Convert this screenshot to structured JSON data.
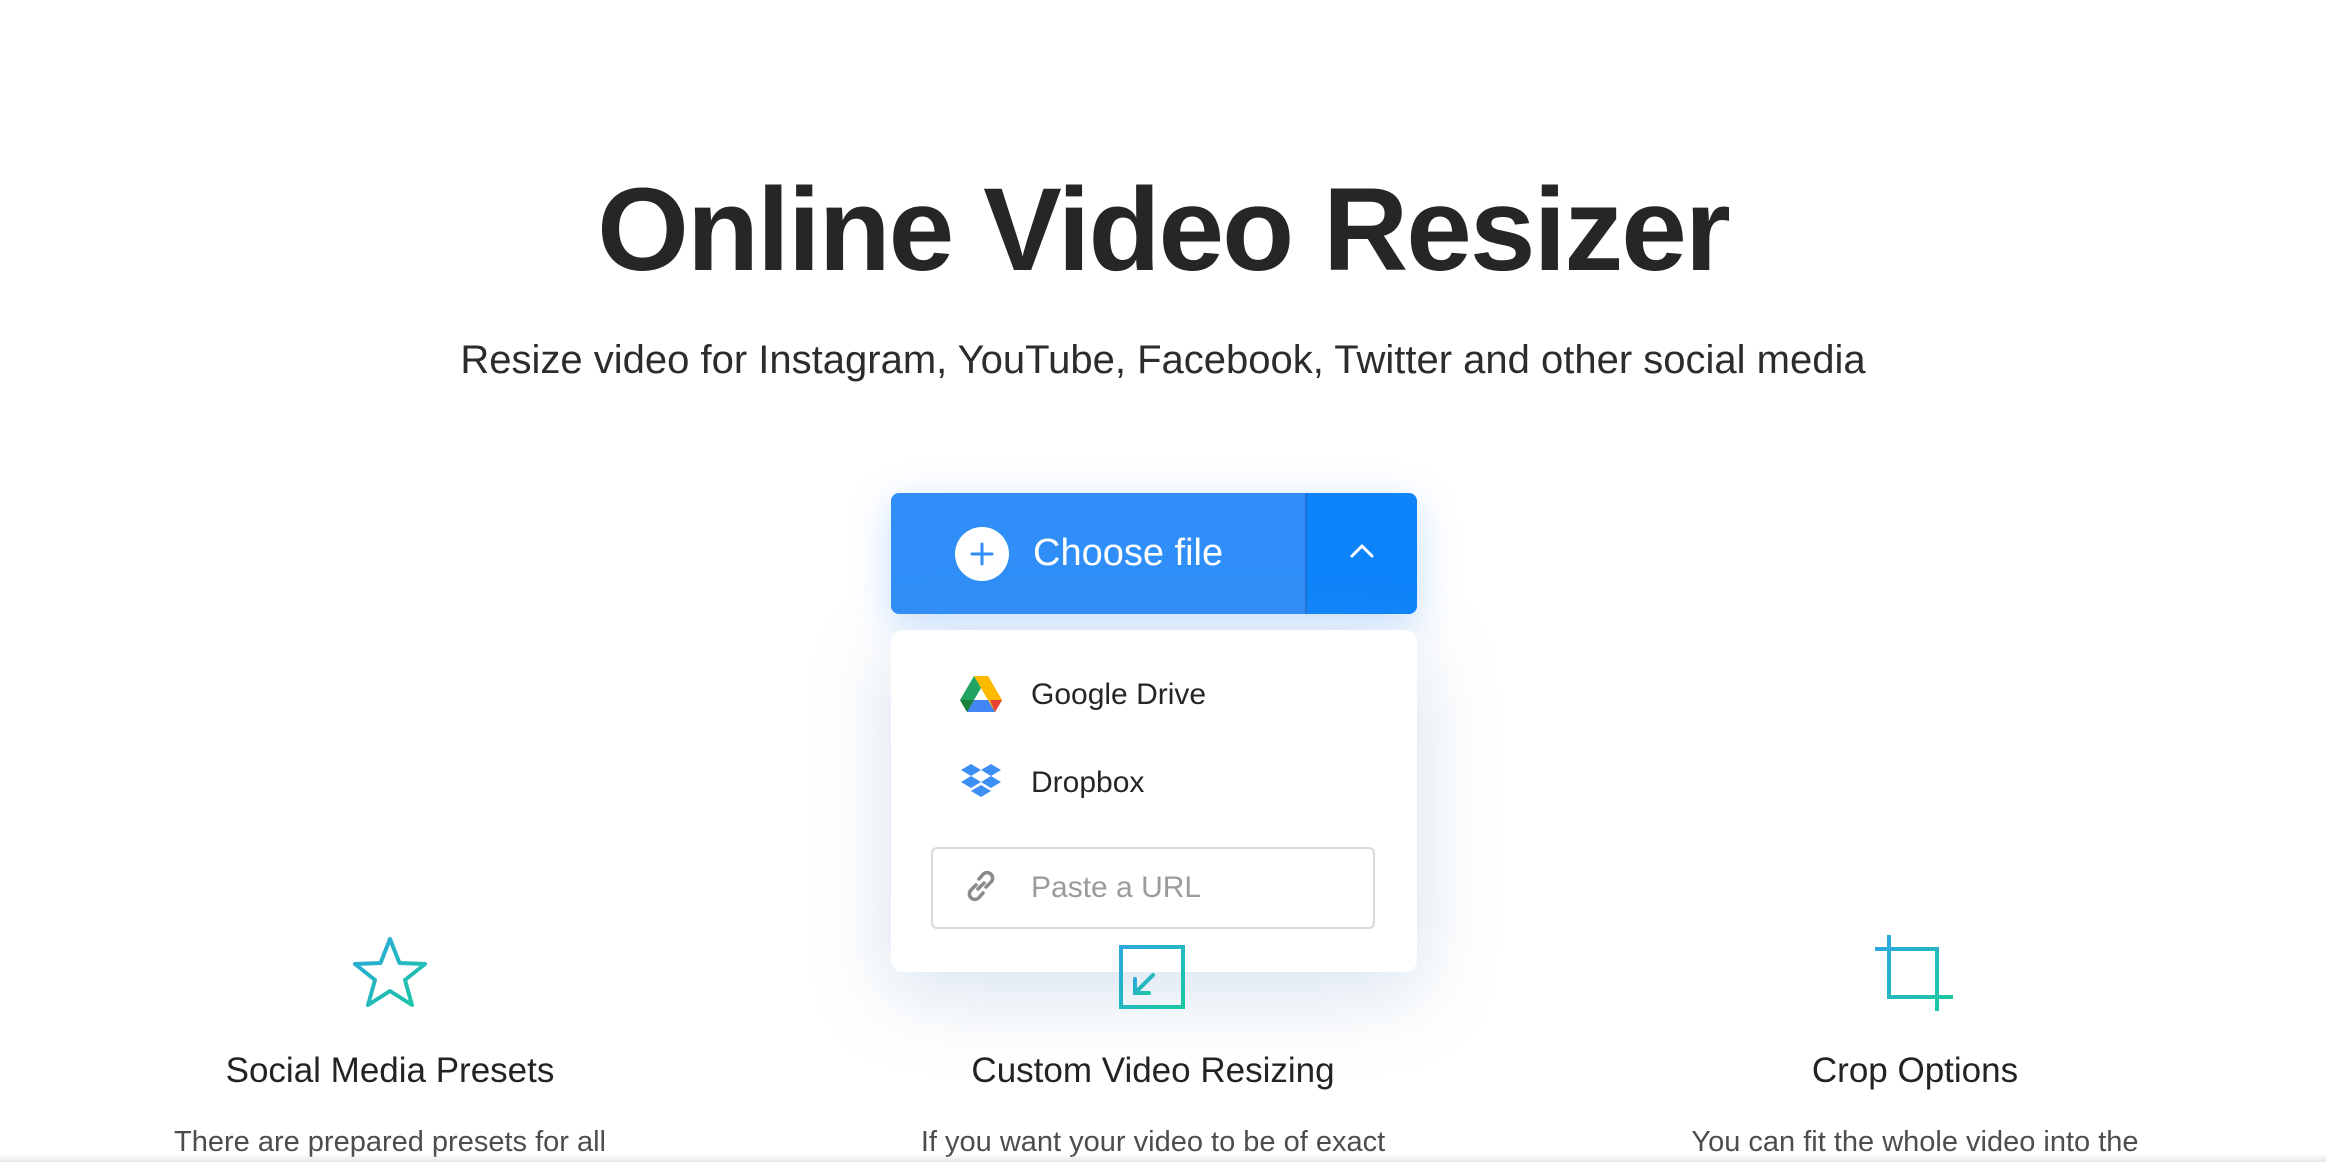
{
  "hero": {
    "title": "Online Video Resizer",
    "subtitle": "Resize video for Instagram, YouTube, Facebook, Twitter and other social media"
  },
  "upload": {
    "choose_label": "Choose file",
    "toggle_icon": "chevron-up-icon",
    "plus_icon": "plus-circle-icon"
  },
  "dropdown": {
    "items": [
      {
        "label": "Google Drive",
        "icon": "google-drive-icon"
      },
      {
        "label": "Dropbox",
        "icon": "dropbox-icon"
      }
    ],
    "url_placeholder": "Paste a URL",
    "url_icon": "link-icon"
  },
  "features": [
    {
      "icon": "star-icon",
      "title": "Social Media Presets",
      "text": "There are prepared presets for all"
    },
    {
      "icon": "resize-icon",
      "title": "Custom Video Resizing",
      "text": "If you want your video to be of exact"
    },
    {
      "icon": "crop-icon",
      "title": "Crop Options",
      "text": "You can fit the whole video into the"
    }
  ],
  "colors": {
    "primary": "#2f8ef7",
    "primary_dark": "#0e84fa",
    "feature_gradient_start": "#2ba8e0",
    "feature_gradient_end": "#1cc7a0"
  }
}
